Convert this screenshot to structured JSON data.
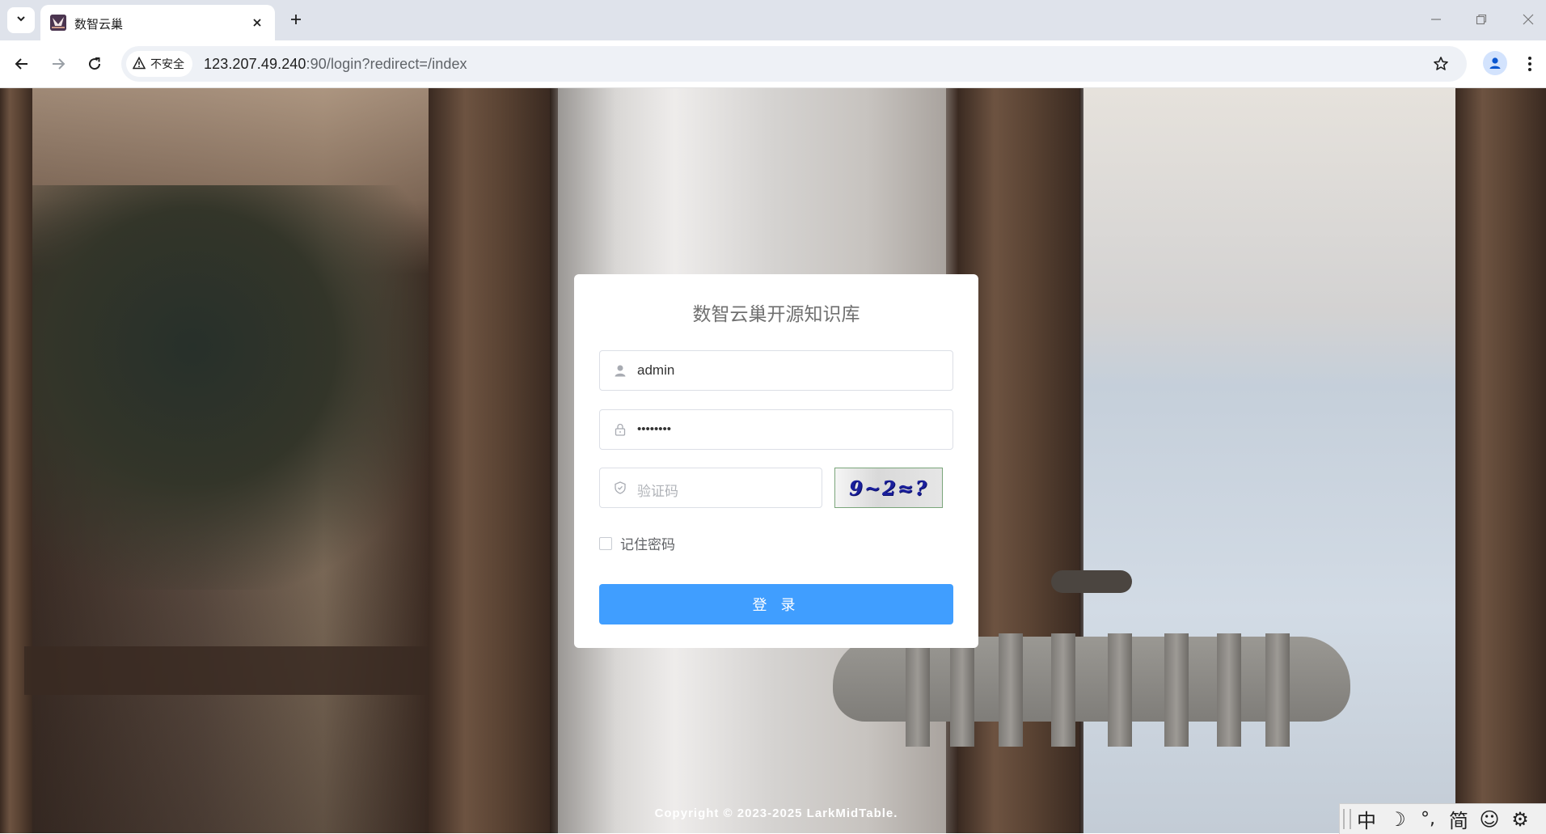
{
  "browser": {
    "tab_title": "数智云巢",
    "security_label": "不安全",
    "url_host": "123.207.49.240",
    "url_path": ":90/login?redirect=/index"
  },
  "login": {
    "title": "数智云巢开源知识库",
    "username_value": "admin",
    "password_value": "••••••••",
    "captcha_placeholder": "验证码",
    "captcha_text": "9~2≈?",
    "remember_label": "记住密码",
    "submit_label": "登 录"
  },
  "footer": {
    "copyright": "Copyright © 2023-2025 LarkMidTable."
  },
  "ime": {
    "mode": "中",
    "moon": "☽",
    "punct": "°,",
    "simplified": "简",
    "emoji": "☺",
    "settings": "⚙"
  },
  "colors": {
    "primary": "#409eff",
    "title_text": "#707070",
    "chrome_bg": "#dfe3eb"
  },
  "icons": [
    "chevron-down-icon",
    "favicon-icon",
    "close-icon",
    "plus-icon",
    "minimize-icon",
    "restore-icon",
    "window-close-icon",
    "back-icon",
    "forward-icon",
    "reload-icon",
    "warning-icon",
    "star-icon",
    "profile-icon",
    "kebab-menu-icon",
    "user-icon",
    "lock-icon",
    "shield-icon"
  ]
}
